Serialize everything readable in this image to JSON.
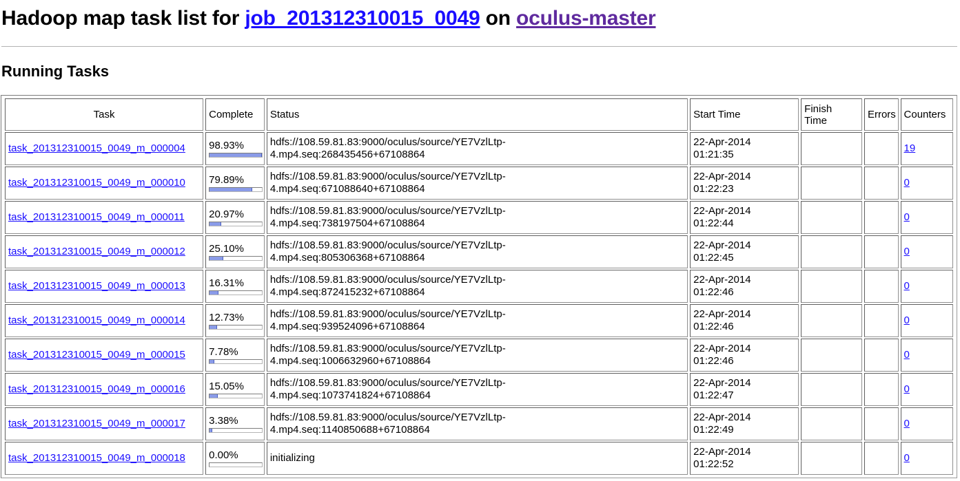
{
  "header": {
    "prefix": "Hadoop map task list for ",
    "job_link": "job_201312310015_0049",
    "middle": " on ",
    "master_link": "oculus-master"
  },
  "section": {
    "title": "Running Tasks"
  },
  "table": {
    "columns": [
      "Task",
      "Complete",
      "Status",
      "Start Time",
      "Finish Time",
      "Errors",
      "Counters"
    ],
    "rows": [
      {
        "task": "task_201312310015_0049_m_000004",
        "complete": "98.93%",
        "progress": 0.9893,
        "status_line1": "hdfs://108.59.81.83:9000/oculus/source/YE7VzlLtp-",
        "status_line2": "4.mp4.seq:268435456+67108864",
        "start_date": "22-Apr-2014",
        "start_time": "01:21:35",
        "finish_time": "",
        "errors": "",
        "counters": "19"
      },
      {
        "task": "task_201312310015_0049_m_000010",
        "complete": "79.89%",
        "progress": 0.7989,
        "status_line1": "hdfs://108.59.81.83:9000/oculus/source/YE7VzlLtp-",
        "status_line2": "4.mp4.seq:671088640+67108864",
        "start_date": "22-Apr-2014",
        "start_time": "01:22:23",
        "finish_time": "",
        "errors": "",
        "counters": "0"
      },
      {
        "task": "task_201312310015_0049_m_000011",
        "complete": "20.97%",
        "progress": 0.2097,
        "status_line1": "hdfs://108.59.81.83:9000/oculus/source/YE7VzlLtp-",
        "status_line2": "4.mp4.seq:738197504+67108864",
        "start_date": "22-Apr-2014",
        "start_time": "01:22:44",
        "finish_time": "",
        "errors": "",
        "counters": "0"
      },
      {
        "task": "task_201312310015_0049_m_000012",
        "complete": "25.10%",
        "progress": 0.251,
        "status_line1": "hdfs://108.59.81.83:9000/oculus/source/YE7VzlLtp-",
        "status_line2": "4.mp4.seq:805306368+67108864",
        "start_date": "22-Apr-2014",
        "start_time": "01:22:45",
        "finish_time": "",
        "errors": "",
        "counters": "0"
      },
      {
        "task": "task_201312310015_0049_m_000013",
        "complete": "16.31%",
        "progress": 0.1631,
        "status_line1": "hdfs://108.59.81.83:9000/oculus/source/YE7VzlLtp-",
        "status_line2": "4.mp4.seq:872415232+67108864",
        "start_date": "22-Apr-2014",
        "start_time": "01:22:46",
        "finish_time": "",
        "errors": "",
        "counters": "0"
      },
      {
        "task": "task_201312310015_0049_m_000014",
        "complete": "12.73%",
        "progress": 0.1273,
        "status_line1": "hdfs://108.59.81.83:9000/oculus/source/YE7VzlLtp-",
        "status_line2": "4.mp4.seq:939524096+67108864",
        "start_date": "22-Apr-2014",
        "start_time": "01:22:46",
        "finish_time": "",
        "errors": "",
        "counters": "0"
      },
      {
        "task": "task_201312310015_0049_m_000015",
        "complete": "7.78%",
        "progress": 0.0778,
        "status_line1": "hdfs://108.59.81.83:9000/oculus/source/YE7VzlLtp-",
        "status_line2": "4.mp4.seq:1006632960+67108864",
        "start_date": "22-Apr-2014",
        "start_time": "01:22:46",
        "finish_time": "",
        "errors": "",
        "counters": "0"
      },
      {
        "task": "task_201312310015_0049_m_000016",
        "complete": "15.05%",
        "progress": 0.1505,
        "status_line1": "hdfs://108.59.81.83:9000/oculus/source/YE7VzlLtp-",
        "status_line2": "4.mp4.seq:1073741824+67108864",
        "start_date": "22-Apr-2014",
        "start_time": "01:22:47",
        "finish_time": "",
        "errors": "",
        "counters": "0"
      },
      {
        "task": "task_201312310015_0049_m_000017",
        "complete": "3.38%",
        "progress": 0.0338,
        "status_line1": "hdfs://108.59.81.83:9000/oculus/source/YE7VzlLtp-",
        "status_line2": "4.mp4.seq:1140850688+67108864",
        "start_date": "22-Apr-2014",
        "start_time": "01:22:49",
        "finish_time": "",
        "errors": "",
        "counters": "0"
      },
      {
        "task": "task_201312310015_0049_m_000018",
        "complete": "0.00%",
        "progress": 0.0,
        "status_line1": "initializing",
        "status_line2": "",
        "start_date": "22-Apr-2014",
        "start_time": "01:22:52",
        "finish_time": "",
        "errors": "",
        "counters": "0"
      }
    ]
  }
}
